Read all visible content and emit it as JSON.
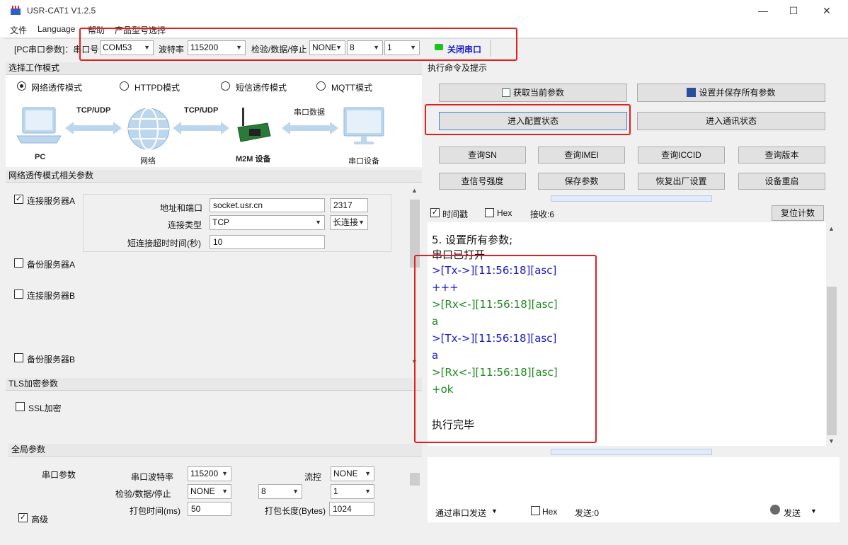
{
  "window": {
    "title": "USR-CAT1 V1.2.5",
    "minimize": "—",
    "maximize": "☐",
    "close": "✕"
  },
  "menu": [
    "文件",
    "Language",
    "帮助",
    "产品型号选择"
  ],
  "toolbar": {
    "pc_params_label": "[PC串口参数]：串口号",
    "port": "COM53",
    "baud_label": "波特率",
    "baud": "115200",
    "parity_label": "检验/数据/停止",
    "parity": "NONE",
    "databits": "8",
    "stopbits": "1",
    "close_port": "关闭串口",
    "status_color": "#1ec21e"
  },
  "work_mode": {
    "title": "选择工作模式",
    "modes": [
      "网络透传模式",
      "HTTPD模式",
      "短信透传模式",
      "MQTT模式"
    ],
    "selected": 0,
    "diagram": {
      "pc": "PC",
      "tcp1": "TCP/UDP",
      "network": "网络",
      "tcp2": "TCP/UDP",
      "m2m": "M2M 设备",
      "serial_data": "串口数据",
      "serial_device": "串口设备"
    }
  },
  "net_params": {
    "title": "网络透传模式相关参数",
    "server_a": "连接服务器A",
    "server_a_checked": true,
    "addr_label": "地址和端口",
    "addr": "socket.usr.cn",
    "port": "2317",
    "conn_type_label": "连接类型",
    "conn_type": "TCP",
    "conn_mode": "长连接",
    "timeout_label": "短连接超时时间(秒)",
    "timeout": "10",
    "backup_a": "备份服务器A",
    "server_b": "连接服务器B",
    "backup_b": "备份服务器B"
  },
  "tls": {
    "title": "TLS加密参数",
    "ssl": "SSL加密"
  },
  "global": {
    "title": "全局参数",
    "serial_params": "串口参数",
    "baud_label": "串口波特率",
    "baud": "115200",
    "flow_label": "流控",
    "flow": "NONE",
    "parity_label": "检验/数据/停止",
    "parity": "NONE",
    "databits": "8",
    "stopbits": "1",
    "pack_time_label": "打包时间(ms)",
    "pack_time": "50",
    "pack_len_label": "打包长度(Bytes)",
    "pack_len": "1024",
    "advanced": "高级"
  },
  "commands": {
    "title": "执行命令及提示",
    "get_params": "获取当前参数",
    "save_all": "设置并保存所有参数",
    "enter_config": "进入配置状态",
    "enter_comm": "进入通讯状态",
    "query_sn": "查询SN",
    "query_imei": "查询IMEI",
    "query_iccid": "查询ICCID",
    "query_version": "查询版本",
    "query_signal": "查信号强度",
    "save_params": "保存参数",
    "factory_reset": "恢复出厂设置",
    "reboot": "设备重启"
  },
  "log": {
    "timestamp": "时间戳",
    "hex": "Hex",
    "received": "接收:6",
    "reset_count": "复位计数",
    "lines": [
      {
        "text": "5. 设置所有参数;",
        "color": "#111111"
      },
      {
        "text": "串口已打开",
        "color": "#111111"
      },
      {
        "text": ">[Tx->][11:56:18][asc]",
        "color": "#1a1ad0"
      },
      {
        "text": "+++",
        "color": "#1a1ad0"
      },
      {
        "text": ">[Rx<-][11:56:18][asc]",
        "color": "#1e8a1e"
      },
      {
        "text": "a",
        "color": "#1e8a1e"
      },
      {
        "text": ">[Tx->][11:56:18][asc]",
        "color": "#1a1ad0"
      },
      {
        "text": "a",
        "color": "#1a1ad0"
      },
      {
        "text": ">[Rx<-][11:56:18][asc]",
        "color": "#1e8a1e"
      },
      {
        "text": "+ok",
        "color": "#1e8a1e"
      },
      {
        "text": "",
        "color": "#111111"
      },
      {
        "text": "执行完毕",
        "color": "#111111"
      }
    ]
  },
  "send": {
    "via_serial": "通过串口发送",
    "hex": "Hex",
    "sent": "发送:0",
    "send_btn": "发送"
  }
}
